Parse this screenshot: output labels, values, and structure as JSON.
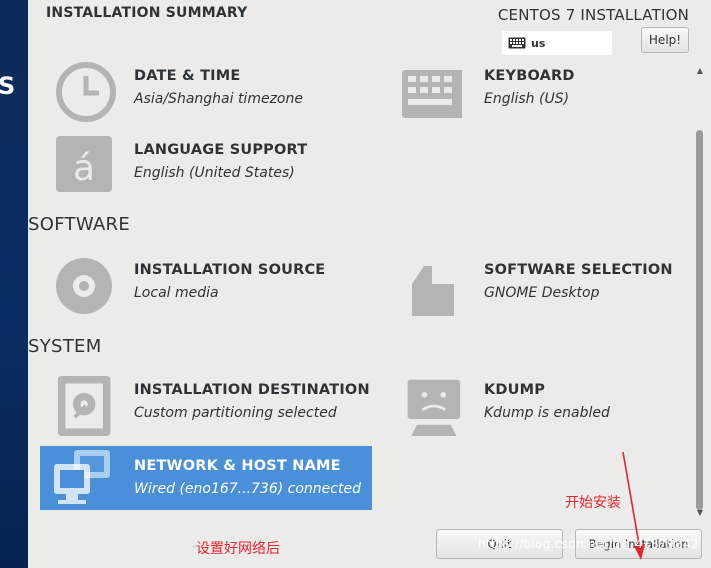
{
  "header": {
    "summary_title": "INSTALLATION SUMMARY",
    "install_title": "CENTOS 7 INSTALLATION",
    "keyboard_layout": "us",
    "help_label": "Help!"
  },
  "sidebar": {
    "logo_fragment": "S"
  },
  "sections": {
    "localization_spokes": [
      {
        "name": "DATE & TIME",
        "status": "Asia/Shanghai timezone",
        "icon": "clock-icon"
      },
      {
        "name": "KEYBOARD",
        "status": "English (US)",
        "icon": "keyboard-icon"
      },
      {
        "name": "LANGUAGE SUPPORT",
        "status": "English (United States)",
        "icon": "language-icon"
      }
    ],
    "software": {
      "heading": "SOFTWARE",
      "spokes": [
        {
          "name": "INSTALLATION SOURCE",
          "status": "Local media",
          "icon": "disc-icon"
        },
        {
          "name": "SOFTWARE SELECTION",
          "status": "GNOME Desktop",
          "icon": "package-icon"
        }
      ]
    },
    "system": {
      "heading": "SYSTEM",
      "spokes": [
        {
          "name": "INSTALLATION DESTINATION",
          "status": "Custom partitioning selected",
          "icon": "harddisk-icon"
        },
        {
          "name": "KDUMP",
          "status": "Kdump is enabled",
          "icon": "kdump-icon"
        },
        {
          "name": "NETWORK & HOST NAME",
          "status": "Wired (eno167...736) connected",
          "icon": "network-icon"
        }
      ]
    }
  },
  "footer": {
    "quit_label": "Quit",
    "begin_label": "Begin Installation"
  },
  "annotations": {
    "network_note": "设置好网络后",
    "begin_note": "开始安装",
    "watermark": "https://blog.csdn.net/qq_41879842"
  },
  "colors": {
    "selected": "#4a90d9",
    "sidebar": "#0b2a59",
    "annotation": "#e3262c"
  }
}
